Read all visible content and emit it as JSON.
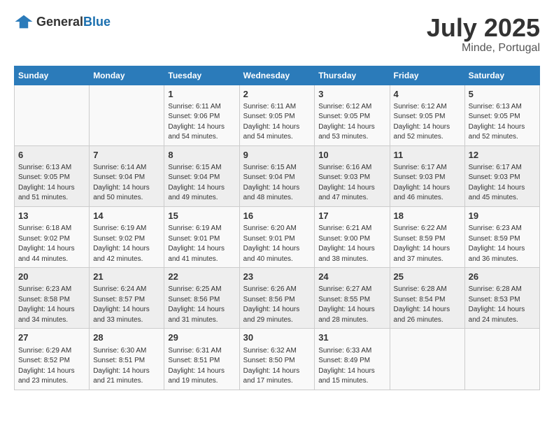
{
  "header": {
    "logo_general": "General",
    "logo_blue": "Blue",
    "month_title": "July 2025",
    "location": "Minde, Portugal"
  },
  "weekdays": [
    "Sunday",
    "Monday",
    "Tuesday",
    "Wednesday",
    "Thursday",
    "Friday",
    "Saturday"
  ],
  "weeks": [
    [
      {
        "day": "",
        "content": ""
      },
      {
        "day": "",
        "content": ""
      },
      {
        "day": "1",
        "content": "Sunrise: 6:11 AM\nSunset: 9:06 PM\nDaylight: 14 hours and 54 minutes."
      },
      {
        "day": "2",
        "content": "Sunrise: 6:11 AM\nSunset: 9:05 PM\nDaylight: 14 hours and 54 minutes."
      },
      {
        "day": "3",
        "content": "Sunrise: 6:12 AM\nSunset: 9:05 PM\nDaylight: 14 hours and 53 minutes."
      },
      {
        "day": "4",
        "content": "Sunrise: 6:12 AM\nSunset: 9:05 PM\nDaylight: 14 hours and 52 minutes."
      },
      {
        "day": "5",
        "content": "Sunrise: 6:13 AM\nSunset: 9:05 PM\nDaylight: 14 hours and 52 minutes."
      }
    ],
    [
      {
        "day": "6",
        "content": "Sunrise: 6:13 AM\nSunset: 9:05 PM\nDaylight: 14 hours and 51 minutes."
      },
      {
        "day": "7",
        "content": "Sunrise: 6:14 AM\nSunset: 9:04 PM\nDaylight: 14 hours and 50 minutes."
      },
      {
        "day": "8",
        "content": "Sunrise: 6:15 AM\nSunset: 9:04 PM\nDaylight: 14 hours and 49 minutes."
      },
      {
        "day": "9",
        "content": "Sunrise: 6:15 AM\nSunset: 9:04 PM\nDaylight: 14 hours and 48 minutes."
      },
      {
        "day": "10",
        "content": "Sunrise: 6:16 AM\nSunset: 9:03 PM\nDaylight: 14 hours and 47 minutes."
      },
      {
        "day": "11",
        "content": "Sunrise: 6:17 AM\nSunset: 9:03 PM\nDaylight: 14 hours and 46 minutes."
      },
      {
        "day": "12",
        "content": "Sunrise: 6:17 AM\nSunset: 9:03 PM\nDaylight: 14 hours and 45 minutes."
      }
    ],
    [
      {
        "day": "13",
        "content": "Sunrise: 6:18 AM\nSunset: 9:02 PM\nDaylight: 14 hours and 44 minutes."
      },
      {
        "day": "14",
        "content": "Sunrise: 6:19 AM\nSunset: 9:02 PM\nDaylight: 14 hours and 42 minutes."
      },
      {
        "day": "15",
        "content": "Sunrise: 6:19 AM\nSunset: 9:01 PM\nDaylight: 14 hours and 41 minutes."
      },
      {
        "day": "16",
        "content": "Sunrise: 6:20 AM\nSunset: 9:01 PM\nDaylight: 14 hours and 40 minutes."
      },
      {
        "day": "17",
        "content": "Sunrise: 6:21 AM\nSunset: 9:00 PM\nDaylight: 14 hours and 38 minutes."
      },
      {
        "day": "18",
        "content": "Sunrise: 6:22 AM\nSunset: 8:59 PM\nDaylight: 14 hours and 37 minutes."
      },
      {
        "day": "19",
        "content": "Sunrise: 6:23 AM\nSunset: 8:59 PM\nDaylight: 14 hours and 36 minutes."
      }
    ],
    [
      {
        "day": "20",
        "content": "Sunrise: 6:23 AM\nSunset: 8:58 PM\nDaylight: 14 hours and 34 minutes."
      },
      {
        "day": "21",
        "content": "Sunrise: 6:24 AM\nSunset: 8:57 PM\nDaylight: 14 hours and 33 minutes."
      },
      {
        "day": "22",
        "content": "Sunrise: 6:25 AM\nSunset: 8:56 PM\nDaylight: 14 hours and 31 minutes."
      },
      {
        "day": "23",
        "content": "Sunrise: 6:26 AM\nSunset: 8:56 PM\nDaylight: 14 hours and 29 minutes."
      },
      {
        "day": "24",
        "content": "Sunrise: 6:27 AM\nSunset: 8:55 PM\nDaylight: 14 hours and 28 minutes."
      },
      {
        "day": "25",
        "content": "Sunrise: 6:28 AM\nSunset: 8:54 PM\nDaylight: 14 hours and 26 minutes."
      },
      {
        "day": "26",
        "content": "Sunrise: 6:28 AM\nSunset: 8:53 PM\nDaylight: 14 hours and 24 minutes."
      }
    ],
    [
      {
        "day": "27",
        "content": "Sunrise: 6:29 AM\nSunset: 8:52 PM\nDaylight: 14 hours and 23 minutes."
      },
      {
        "day": "28",
        "content": "Sunrise: 6:30 AM\nSunset: 8:51 PM\nDaylight: 14 hours and 21 minutes."
      },
      {
        "day": "29",
        "content": "Sunrise: 6:31 AM\nSunset: 8:51 PM\nDaylight: 14 hours and 19 minutes."
      },
      {
        "day": "30",
        "content": "Sunrise: 6:32 AM\nSunset: 8:50 PM\nDaylight: 14 hours and 17 minutes."
      },
      {
        "day": "31",
        "content": "Sunrise: 6:33 AM\nSunset: 8:49 PM\nDaylight: 14 hours and 15 minutes."
      },
      {
        "day": "",
        "content": ""
      },
      {
        "day": "",
        "content": ""
      }
    ]
  ]
}
